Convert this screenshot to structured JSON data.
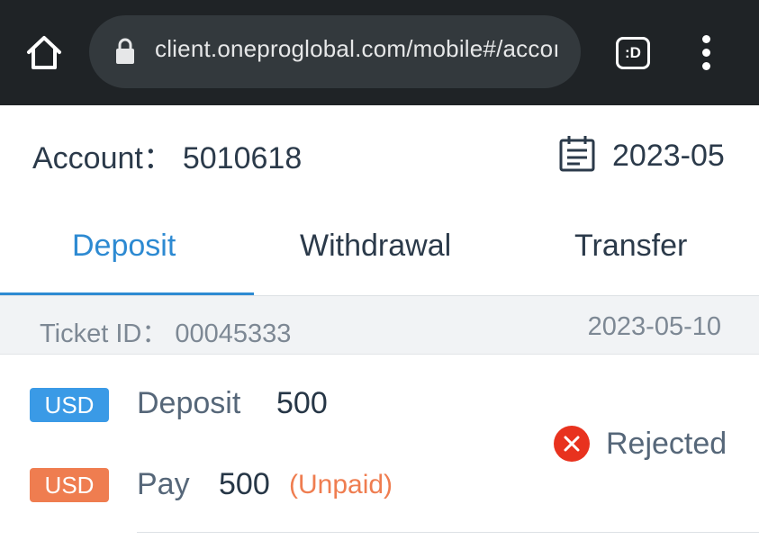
{
  "browser": {
    "url": "client.oneproglobal.com/mobile#/accoı",
    "tab_switcher_label": ":D"
  },
  "header": {
    "account_label": "Account",
    "account_separator": "：",
    "account_number": "5010618",
    "month": "2023-05"
  },
  "tabs": [
    {
      "label": "Deposit",
      "active": true
    },
    {
      "label": "Withdrawal",
      "active": false
    },
    {
      "label": "Transfer",
      "active": false
    }
  ],
  "ticket": {
    "id_label": "Ticket ID",
    "id_separator": "：",
    "id": "00045333",
    "date": "2023-05-10",
    "deposit": {
      "currency": "USD",
      "label": "Deposit",
      "amount": "500"
    },
    "pay": {
      "currency": "USD",
      "label": "Pay",
      "amount": "500",
      "note": "(Unpaid)"
    },
    "status": "Rejected"
  },
  "colors": {
    "accent": "#2d8ad2",
    "usd_deposit_badge": "#3a9ae6",
    "usd_pay_badge": "#ef7d50",
    "rejected_icon": "#e8321e"
  },
  "icons": {
    "home": "home-icon",
    "lock": "lock-icon",
    "tab_switcher": "tab-switcher-icon",
    "menu": "more-vert-icon",
    "calendar": "calendar-icon",
    "status": "close-circle-icon"
  }
}
